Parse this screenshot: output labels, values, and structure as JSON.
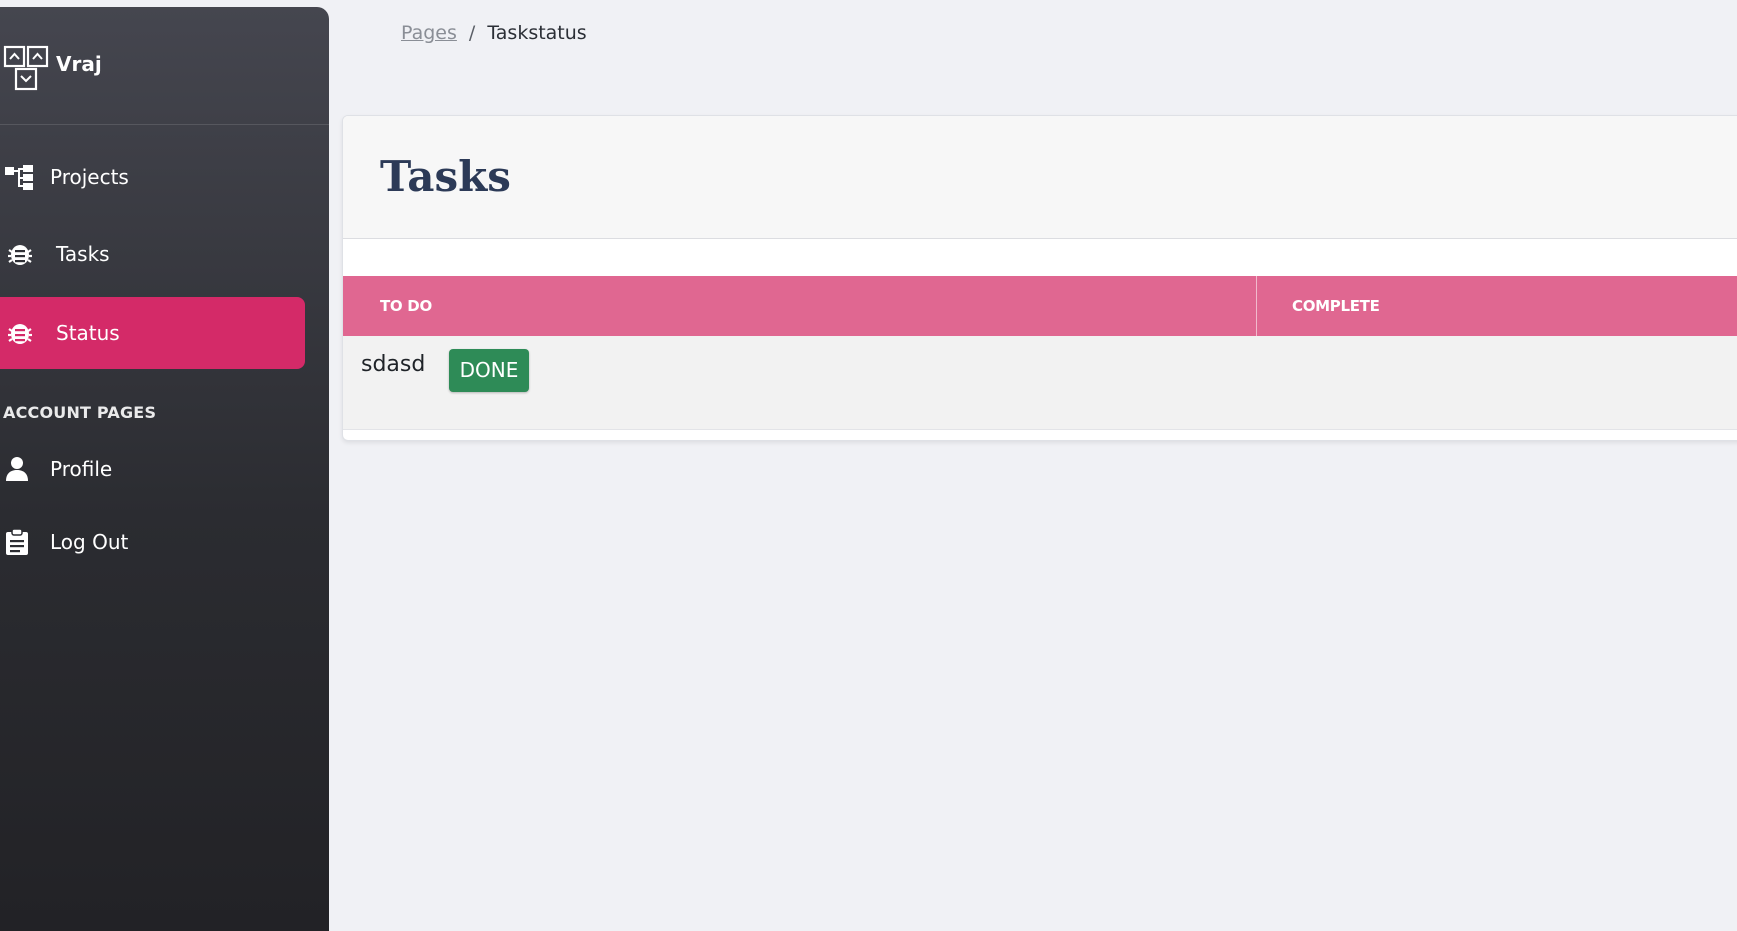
{
  "sidebar": {
    "brand_name": "Vraj",
    "items": [
      {
        "label": "Projects",
        "icon": "sitemap-icon"
      },
      {
        "label": "Tasks",
        "icon": "bug-icon"
      },
      {
        "label": "Status",
        "icon": "bug-icon",
        "active": true
      }
    ],
    "section_title": "ACCOUNT PAGES",
    "account_items": [
      {
        "label": "Profile",
        "icon": "user-icon"
      },
      {
        "label": "Log Out",
        "icon": "clipboard-icon"
      }
    ],
    "active_color": "#d42a68"
  },
  "breadcrumb": {
    "parent": "Pages",
    "separator": "/",
    "current": "Taskstatus"
  },
  "main": {
    "title": "Tasks",
    "table": {
      "headers": [
        "TO DO",
        "COMPLETE"
      ],
      "header_color": "#e06791",
      "rows": [
        {
          "task": "sdasd",
          "action_label": "DONE",
          "action_color": "#2e8b57"
        }
      ]
    }
  }
}
